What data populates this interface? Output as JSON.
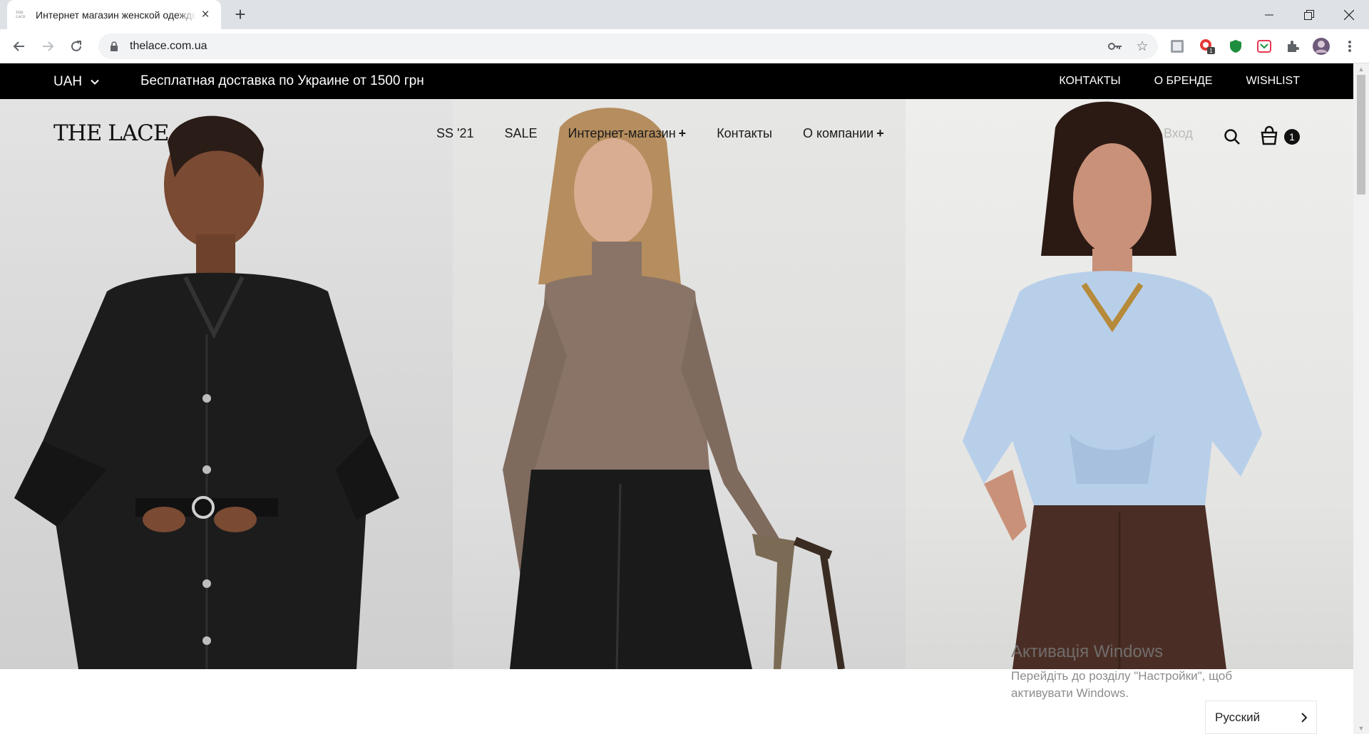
{
  "browser": {
    "tab_title": "Интернет магазин женской одежды THE LACE",
    "tab_favicon_text": "THE LACE",
    "url": "thelace.com.ua",
    "extension_badge": "1"
  },
  "topbar": {
    "currency": "UAH",
    "promo": "Бесплатная доставка по Украине от 1500 грн",
    "links": [
      "КОНТАКТЫ",
      "О БРЕНДЕ",
      "WISHLIST"
    ]
  },
  "header": {
    "logo": "THE LACE",
    "nav": [
      {
        "label": "SS '21",
        "plus": ""
      },
      {
        "label": "SALE",
        "plus": ""
      },
      {
        "label": "Интернет-магазин",
        "plus": "+"
      },
      {
        "label": "Контакты",
        "plus": ""
      },
      {
        "label": "О компании",
        "plus": "+"
      }
    ],
    "login": "Вход",
    "cart_count": "1"
  },
  "watermark": {
    "title": "Активація Windows",
    "text": "Перейдіть до розділу \"Настройки\", щоб активувати Windows."
  },
  "language": {
    "current": "Русский"
  },
  "icons": {
    "currency_toggle": "chevron-down-icon",
    "search": "search-icon",
    "cart": "cart-icon",
    "language_next": "chevron-right-icon"
  }
}
